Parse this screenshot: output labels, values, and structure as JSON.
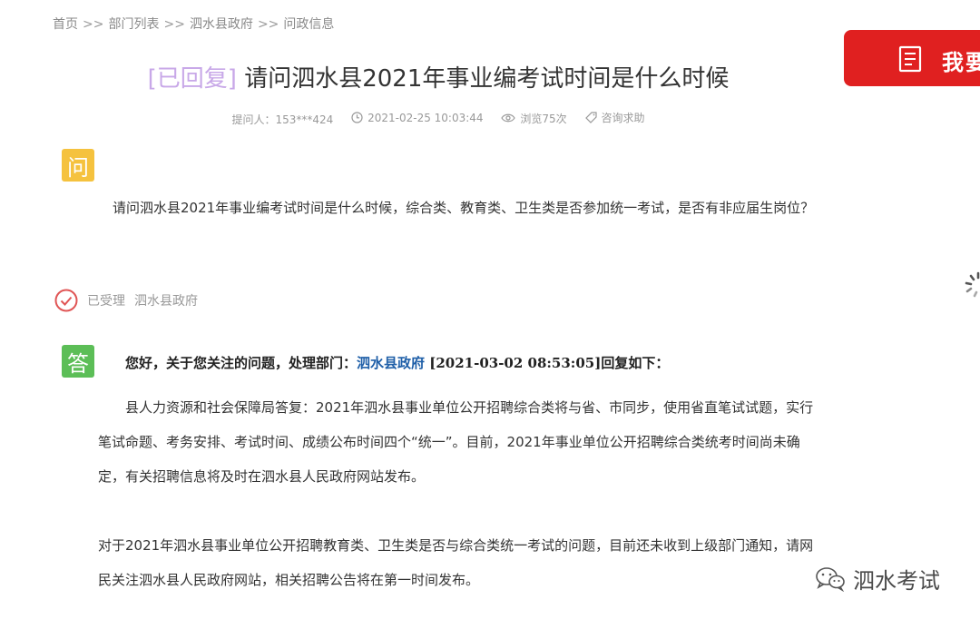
{
  "breadcrumb": {
    "items": [
      "首页",
      "部门列表",
      "泗水县政府",
      "问政信息"
    ],
    "separator": ">>"
  },
  "ask_button": {
    "label": "我要"
  },
  "title": {
    "status": "[已回复]",
    "text": "请问泗水县2021年事业编考试时间是什么时候"
  },
  "meta": {
    "asker": "提问人：153***424",
    "time": "2021-02-25 10:03:44",
    "views": "浏览75次",
    "category": "咨询求助"
  },
  "question": {
    "badge": "问",
    "text": "请问泗水县2021年事业编考试时间是什么时候，综合类、教育类、卫生类是否参加统一考试，是否有非应届生岗位？"
  },
  "status": {
    "label": "已受理",
    "department": "泗水县政府"
  },
  "answer": {
    "badge": "答",
    "header_prefix": "您好，关于您关注的问题，处理部门：",
    "department": "泗水县政府",
    "header_suffix": " [2021-03-02 08:53:05]回复如下：",
    "paragraph1": "县人力资源和社会保障局答复：2021年泗水县事业单位公开招聘综合类将与省、市同步，使用省直笔试试题，实行笔试命题、考务安排、考试时间、成绩公布时间四个“统一”。目前，2021年事业单位公开招聘综合类统考时间尚未确定，有关招聘信息将及时在泗水县人民政府网站发布。",
    "paragraph2": "对于2021年泗水县事业单位公开招聘教育类、卫生类是否与综合类统一考试的问题，目前还未收到上级部门通知，请网民关注泗水县人民政府网站，相关招聘公告将在第一时间发布。"
  },
  "watermark": {
    "text": "泗水考试"
  },
  "colors": {
    "accent_red": "#e02020",
    "question_badge": "#f5c23e",
    "answer_badge": "#5cbe57",
    "status_tag": "#c8a8e8",
    "link_blue": "#1f5fa8",
    "check_red": "#e05555"
  }
}
